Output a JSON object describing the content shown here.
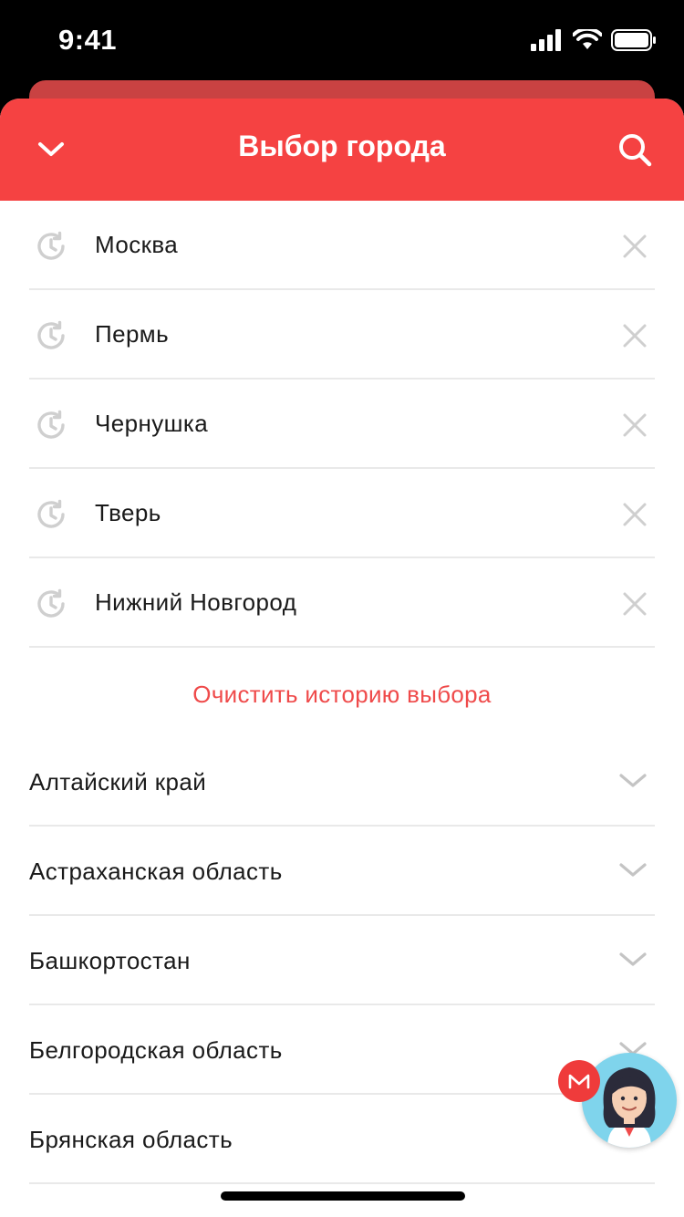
{
  "status_bar": {
    "time": "9:41"
  },
  "header": {
    "title": "Выбор города"
  },
  "history": [
    {
      "city": "Москва"
    },
    {
      "city": "Пермь"
    },
    {
      "city": "Чернушка"
    },
    {
      "city": "Тверь"
    },
    {
      "city": "Нижний Новгород"
    }
  ],
  "clear_history_label": "Очистить историю выбора",
  "regions": [
    {
      "name": "Алтайский край"
    },
    {
      "name": "Астраханская область"
    },
    {
      "name": "Башкортостан"
    },
    {
      "name": "Белгородская область"
    },
    {
      "name": "Брянская область"
    }
  ],
  "colors": {
    "accent": "#f54242",
    "link": "#ef4a4a",
    "divider": "#e9e9e9"
  },
  "icons": {
    "collapse": "chevron-down-icon",
    "search": "search-icon",
    "history": "history-clock-icon",
    "remove": "close-icon",
    "expand": "chevron-down-icon"
  }
}
